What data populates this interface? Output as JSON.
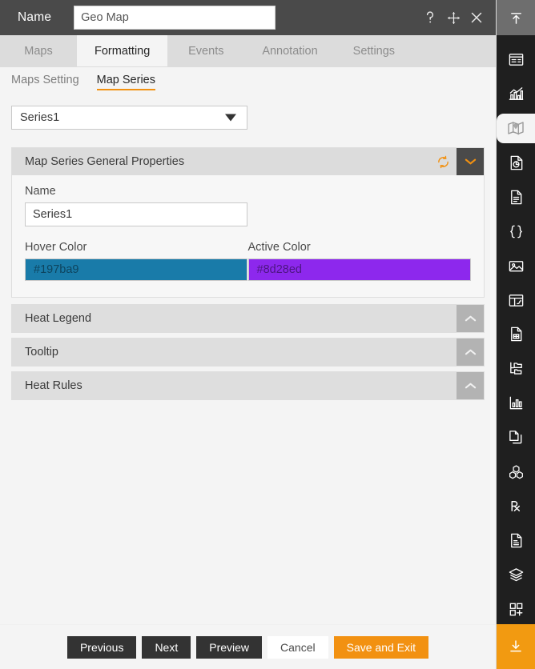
{
  "titlebar": {
    "label": "Name",
    "name_value": "Geo Map",
    "name_placeholder": "Geo Map",
    "help_icon": "question-mark-icon",
    "move_icon": "move-icon",
    "close_icon": "close-icon"
  },
  "tabs": [
    {
      "label": "Maps",
      "active": false
    },
    {
      "label": "Formatting",
      "active": true
    },
    {
      "label": "Events",
      "active": false
    },
    {
      "label": "Annotation",
      "active": false
    },
    {
      "label": "Settings",
      "active": false
    }
  ],
  "subtabs": [
    {
      "label": "Maps Setting",
      "active": false
    },
    {
      "label": "Map Series",
      "active": true
    }
  ],
  "series_select": {
    "value": "Series1",
    "icon": "chevron-down-icon"
  },
  "general_panel": {
    "title": "Map Series General Properties",
    "refresh_icon": "refresh-icon",
    "collapse_icon": "chevron-down-icon",
    "name_label": "Name",
    "name_value": "Series1",
    "name_placeholder": "Series1",
    "hover_color_label": "Hover Color",
    "hover_color_value": "#197ba9",
    "active_color_label": "Active Color",
    "active_color_value": "#8d28ed"
  },
  "collapsed_sections": [
    {
      "title": "Heat Legend",
      "icon": "chevron-up-icon"
    },
    {
      "title": "Tooltip",
      "icon": "chevron-up-icon"
    },
    {
      "title": "Heat Rules",
      "icon": "chevron-up-icon"
    }
  ],
  "footer": {
    "previous": "Previous",
    "next": "Next",
    "preview": "Preview",
    "cancel": "Cancel",
    "save_and_exit": "Save and Exit"
  },
  "rail": {
    "top_icon": "collapse-up-icon",
    "bottom_icon": "download-icon",
    "items": [
      {
        "icon": "form-layout-icon",
        "active": false
      },
      {
        "icon": "bar-chart-icon",
        "active": false
      },
      {
        "icon": "map-icon",
        "active": true
      },
      {
        "icon": "pie-report-icon",
        "active": false
      },
      {
        "icon": "document-icon",
        "active": false
      },
      {
        "icon": "braces-icon",
        "active": false
      },
      {
        "icon": "image-icon",
        "active": false
      },
      {
        "icon": "table-icon",
        "active": false
      },
      {
        "icon": "spreadsheet-icon",
        "active": false
      },
      {
        "icon": "tree-folder-icon",
        "active": false
      },
      {
        "icon": "column-chart-icon",
        "active": false
      },
      {
        "icon": "copy-page-icon",
        "active": false
      },
      {
        "icon": "cubes-icon",
        "active": false
      },
      {
        "icon": "prescription-icon",
        "active": false
      },
      {
        "icon": "file-list-icon",
        "active": false
      },
      {
        "icon": "layers-icon",
        "active": false
      },
      {
        "icon": "add-widget-icon",
        "active": false
      }
    ]
  },
  "colors": {
    "accent_orange": "#f29111",
    "titlebar_bg": "#4a4a4a",
    "rail_bg": "#1f1f1f",
    "panel_header_bg": "#dcdcdc"
  }
}
